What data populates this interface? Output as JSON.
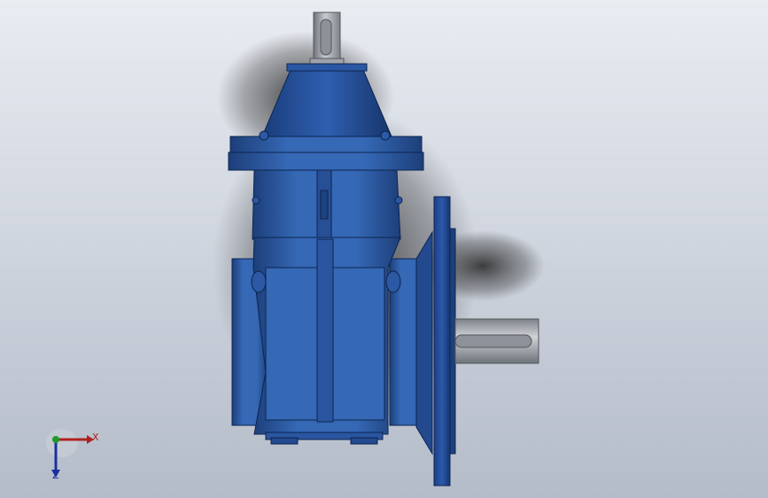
{
  "viewport": {
    "background_top": "#e9ecf1",
    "background_bottom": "#b4bcc9"
  },
  "model": {
    "part": "gearbox",
    "body_color": "#2f5fa8",
    "body_dark": "#1d3f7a",
    "body_light": "#4c80cf",
    "shaft_color": "#9ea3ab"
  },
  "triad": {
    "x_label": "X",
    "y_label": "",
    "z_label": "Z",
    "x_color": "#b02020",
    "y_color": "#1f9a2a",
    "z_color": "#1c2f9e"
  }
}
